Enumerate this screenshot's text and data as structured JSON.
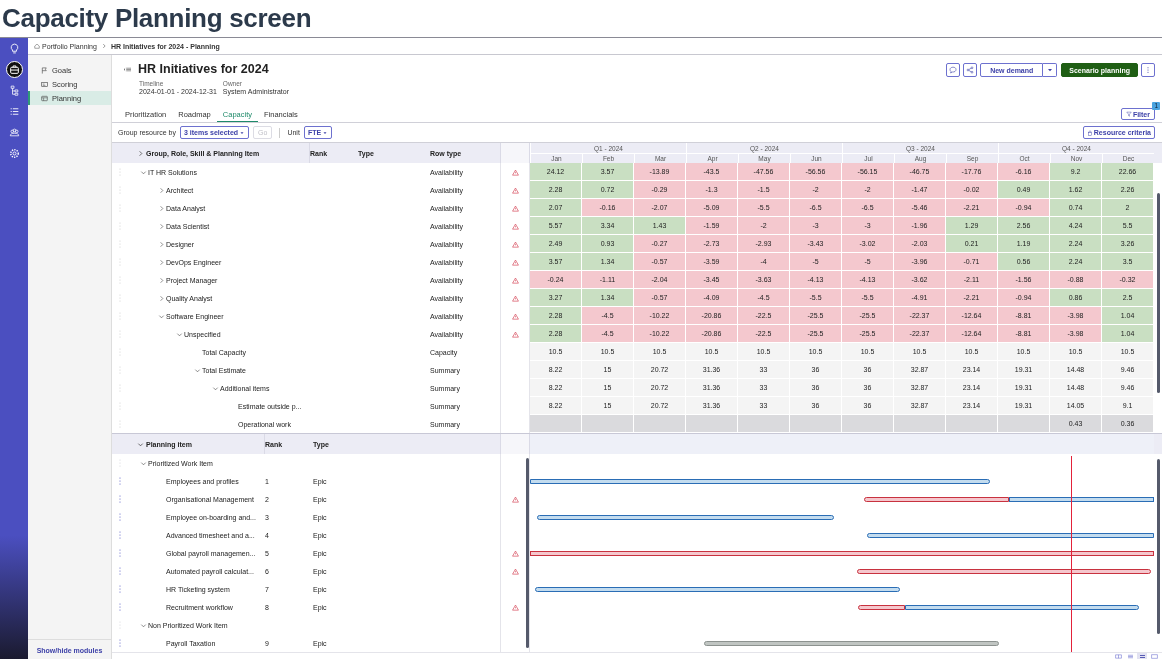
{
  "page_title": "Capacity Planning screen",
  "rail": [
    {
      "selected": false
    },
    {
      "selected": true
    },
    {
      "selected": false
    },
    {
      "selected": false
    },
    {
      "selected": false
    },
    {
      "selected": false
    }
  ],
  "breadcrumb": [
    "Portfolio Planning",
    "HR Initiatives for 2024 - Planning"
  ],
  "modules": [
    {
      "label": "Goals",
      "selected": false
    },
    {
      "label": "Scoring",
      "selected": false
    },
    {
      "label": "Planning",
      "selected": true
    }
  ],
  "show_hide": "Show/hide modules",
  "header": {
    "title": "HR Initiatives for 2024",
    "fields": [
      {
        "label": "Timeline",
        "value": "2024-01-01 - 2024-12-31"
      },
      {
        "label": "Owner",
        "value": "System Administrator"
      }
    ]
  },
  "actions": {
    "new_demand": "New demand",
    "scenario": "Scenario planning"
  },
  "tabs": [
    {
      "label": "Prioritization",
      "selected": false
    },
    {
      "label": "Roadmap",
      "selected": false
    },
    {
      "label": "Capacity",
      "selected": true
    },
    {
      "label": "Financials",
      "selected": false
    }
  ],
  "filter": {
    "label": "Filter",
    "badge": "1"
  },
  "toolbar": {
    "group_label": "Group resource by",
    "group_value": "3 items selected",
    "go": {
      "label": "Go",
      "disabled": true
    },
    "unit_label": "Unit",
    "unit_value": "FTE",
    "criteria": "Resource criteria"
  },
  "capacity": {
    "columns": {
      "name": "Group, Role, Skill & Planning Item",
      "name_expanded": false,
      "rank": "Rank",
      "type": "Type",
      "row_type": "Row type"
    },
    "quarters": [
      "Q1 - 2024",
      "Q2 - 2024",
      "Q3 - 2024",
      "Q4 - 2024"
    ],
    "months": [
      "Jan",
      "Feb",
      "Mar",
      "Apr",
      "May",
      "Jun",
      "Jul",
      "Aug",
      "Sep",
      "Oct",
      "Nov",
      "Dec"
    ],
    "rows": [
      {
        "name": "IT HR Solutions",
        "expanded": true,
        "row_type": "Availability",
        "warning": true,
        "kind": "availability",
        "cells": [
          "24.12",
          "3.57",
          "-13.89",
          "-43.5",
          "-47.56",
          "-56.56",
          "-56.15",
          "-46.75",
          "-17.76",
          "-6.16",
          "9.2",
          "22.66"
        ],
        "surplus": [
          true,
          true,
          false,
          false,
          false,
          false,
          false,
          false,
          false,
          false,
          true,
          true
        ],
        "children": [
          {
            "name": "Architect",
            "expanded": false,
            "row_type": "Availability",
            "warning": true,
            "kind": "availability",
            "cells": [
              "2.28",
              "0.72",
              "-0.29",
              "-1.3",
              "-1.5",
              "-2",
              "-2",
              "-1.47",
              "-0.02",
              "0.49",
              "1.62",
              "2.26"
            ],
            "surplus": [
              true,
              true,
              false,
              false,
              false,
              false,
              false,
              false,
              false,
              true,
              true,
              true
            ]
          },
          {
            "name": "Data Analyst",
            "expanded": false,
            "row_type": "Availability",
            "warning": true,
            "kind": "availability",
            "cells": [
              "2.07",
              "-0.16",
              "-2.07",
              "-5.09",
              "-5.5",
              "-6.5",
              "-6.5",
              "-5.46",
              "-2.21",
              "-0.94",
              "0.74",
              "2"
            ],
            "surplus": [
              true,
              false,
              false,
              false,
              false,
              false,
              false,
              false,
              false,
              false,
              true,
              true
            ]
          },
          {
            "name": "Data Scientist",
            "expanded": false,
            "row_type": "Availability",
            "warning": true,
            "kind": "availability",
            "cells": [
              "5.57",
              "3.34",
              "1.43",
              "-1.59",
              "-2",
              "-3",
              "-3",
              "-1.96",
              "1.29",
              "2.56",
              "4.24",
              "5.5"
            ],
            "surplus": [
              true,
              true,
              true,
              false,
              false,
              false,
              false,
              false,
              true,
              true,
              true,
              true
            ]
          },
          {
            "name": "Designer",
            "expanded": false,
            "row_type": "Availability",
            "warning": true,
            "kind": "availability",
            "cells": [
              "2.49",
              "0.93",
              "-0.27",
              "-2.73",
              "-2.93",
              "-3.43",
              "-3.02",
              "-2.03",
              "0.21",
              "1.19",
              "2.24",
              "3.26"
            ],
            "surplus": [
              true,
              true,
              false,
              false,
              false,
              false,
              false,
              false,
              true,
              true,
              true,
              true
            ]
          },
          {
            "name": "DevOps Engineer",
            "expanded": false,
            "row_type": "Availability",
            "warning": true,
            "kind": "availability",
            "cells": [
              "3.57",
              "1.34",
              "-0.57",
              "-3.59",
              "-4",
              "-5",
              "-5",
              "-3.96",
              "-0.71",
              "0.56",
              "2.24",
              "3.5"
            ],
            "surplus": [
              true,
              true,
              false,
              false,
              false,
              false,
              false,
              false,
              false,
              true,
              true,
              true
            ]
          },
          {
            "name": "Project Manager",
            "expanded": false,
            "row_type": "Availability",
            "warning": true,
            "kind": "availability",
            "cells": [
              "-0.24",
              "-1.11",
              "-2.04",
              "-3.45",
              "-3.63",
              "-4.13",
              "-4.13",
              "-3.62",
              "-2.11",
              "-1.56",
              "-0.88",
              "-0.32"
            ],
            "surplus": [
              false,
              false,
              false,
              false,
              false,
              false,
              false,
              false,
              false,
              false,
              false,
              false
            ]
          },
          {
            "name": "Quality Analyst",
            "expanded": false,
            "row_type": "Availability",
            "warning": true,
            "kind": "availability",
            "cells": [
              "3.27",
              "1.34",
              "-0.57",
              "-4.09",
              "-4.5",
              "-5.5",
              "-5.5",
              "-4.91",
              "-2.21",
              "-0.94",
              "0.86",
              "2.5"
            ],
            "surplus": [
              true,
              true,
              false,
              false,
              false,
              false,
              false,
              false,
              false,
              false,
              true,
              true
            ]
          },
          {
            "name": "Software Engineer",
            "expanded": true,
            "row_type": "Availability",
            "warning": true,
            "kind": "availability",
            "cells": [
              "2.28",
              "-4.5",
              "-10.22",
              "-20.86",
              "-22.5",
              "-25.5",
              "-25.5",
              "-22.37",
              "-12.64",
              "-8.81",
              "-3.98",
              "1.04"
            ],
            "surplus": [
              true,
              false,
              false,
              false,
              false,
              false,
              false,
              false,
              false,
              false,
              false,
              true
            ],
            "children": [
              {
                "name": "Unspecified",
                "expanded": true,
                "row_type": "Availability",
                "warning": true,
                "kind": "availability",
                "cells": [
                  "2.28",
                  "-4.5",
                  "-10.22",
                  "-20.86",
                  "-22.5",
                  "-25.5",
                  "-25.5",
                  "-22.37",
                  "-12.64",
                  "-8.81",
                  "-3.98",
                  "1.04"
                ],
                "surplus": [
                  true,
                  false,
                  false,
                  false,
                  false,
                  false,
                  false,
                  false,
                  false,
                  false,
                  false,
                  true
                ],
                "children": [
                  {
                    "name": "Total Capacity",
                    "row_type": "Capacity",
                    "warning": false,
                    "kind": "plain",
                    "cells": [
                      "10.5",
                      "10.5",
                      "10.5",
                      "10.5",
                      "10.5",
                      "10.5",
                      "10.5",
                      "10.5",
                      "10.5",
                      "10.5",
                      "10.5",
                      "10.5"
                    ]
                  },
                  {
                    "name": "Total Estimate",
                    "expanded": true,
                    "row_type": "Summary",
                    "warning": false,
                    "kind": "plain",
                    "cells": [
                      "8.22",
                      "15",
                      "20.72",
                      "31.36",
                      "33",
                      "36",
                      "36",
                      "32.87",
                      "23.14",
                      "19.31",
                      "14.48",
                      "9.46"
                    ],
                    "children": [
                      {
                        "name": "Additional items",
                        "expanded": true,
                        "row_type": "Summary",
                        "warning": false,
                        "kind": "plain",
                        "cells": [
                          "8.22",
                          "15",
                          "20.72",
                          "31.36",
                          "33",
                          "36",
                          "36",
                          "32.87",
                          "23.14",
                          "19.31",
                          "14.48",
                          "9.46"
                        ],
                        "children": [
                          {
                            "name": "Estimate outside p...",
                            "row_type": "Summary",
                            "warning": false,
                            "kind": "plain",
                            "cells": [
                              "8.22",
                              "15",
                              "20.72",
                              "31.36",
                              "33",
                              "36",
                              "36",
                              "32.87",
                              "23.14",
                              "19.31",
                              "14.05",
                              "9.1"
                            ]
                          },
                          {
                            "name": "Operational work",
                            "row_type": "Summary",
                            "warning": false,
                            "kind": "shaded",
                            "cells": [
                              null,
                              null,
                              null,
                              null,
                              null,
                              null,
                              null,
                              null,
                              null,
                              null,
                              "0.43",
                              "0.36"
                            ]
                          }
                        ]
                      }
                    ]
                  }
                ]
              }
            ]
          }
        ]
      }
    ]
  },
  "planning": {
    "columns": {
      "name": "Planning item",
      "name_expanded": true,
      "rank": "Rank",
      "type": "Type"
    },
    "groups": [
      {
        "name": "Prioritized Work Item",
        "expanded": true,
        "children": [
          {
            "name": "Employees and profiles",
            "rank": "1",
            "type": "Epic",
            "warning": false
          },
          {
            "name": "Organisational Management",
            "rank": "2",
            "type": "Epic",
            "warning": true
          },
          {
            "name": "Employee on-boarding and...",
            "rank": "3",
            "type": "Epic",
            "warning": false
          },
          {
            "name": "Advanced timesheet and a...",
            "rank": "4",
            "type": "Epic",
            "warning": false
          },
          {
            "name": "Global payroll managemen...",
            "rank": "5",
            "type": "Epic",
            "warning": true
          },
          {
            "name": "Automated payroll calculat...",
            "rank": "6",
            "type": "Epic",
            "warning": true
          },
          {
            "name": "HR Ticketing system",
            "rank": "7",
            "type": "Epic",
            "warning": false
          },
          {
            "name": "Recruitment workflow",
            "rank": "8",
            "type": "Epic",
            "warning": true
          }
        ]
      },
      {
        "name": "Non Prioritized Work Item",
        "expanded": true,
        "children": [
          {
            "name": "Payroll Taxation",
            "rank": "9",
            "type": "Epic",
            "warning": false
          }
        ]
      }
    ]
  },
  "view_modes": [
    {
      "selected": false
    },
    {
      "selected": false
    },
    {
      "selected": true
    },
    {
      "selected": false
    }
  ]
}
